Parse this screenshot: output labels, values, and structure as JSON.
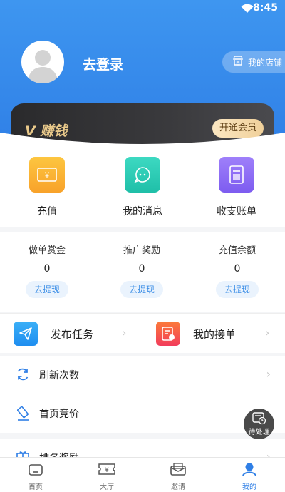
{
  "status": {
    "time": "8:45"
  },
  "profile": {
    "login_label": "去登录",
    "shop_label": "我的店铺"
  },
  "vip": {
    "title": "V 赚钱",
    "button": "开通会员"
  },
  "quick": [
    {
      "label": "充值",
      "icon": "recharge-icon",
      "color": "#fbb32c"
    },
    {
      "label": "我的消息",
      "icon": "message-icon",
      "color": "#24c9b3"
    },
    {
      "label": "收支账单",
      "icon": "bill-icon",
      "color": "#8f6df5"
    }
  ],
  "money": [
    {
      "title": "做单赏金",
      "value": "0",
      "button": "去提现"
    },
    {
      "title": "推广奖励",
      "value": "0",
      "button": "去提现"
    },
    {
      "title": "充值余额",
      "value": "0",
      "button": "去提现"
    }
  ],
  "tasks": [
    {
      "label": "发布任务",
      "icon": "send-icon",
      "color": "#2d9ef3"
    },
    {
      "label": "我的接单",
      "icon": "order-icon",
      "color": "#f4434a"
    }
  ],
  "list": [
    {
      "label": "刷新次数",
      "icon": "refresh-icon"
    },
    {
      "label": "首页竞价",
      "icon": "bid-icon"
    },
    {
      "label": "排名奖励",
      "icon": "ranking-icon"
    }
  ],
  "float": {
    "label": "待处理"
  },
  "tabs": [
    {
      "label": "首页",
      "icon": "home-icon"
    },
    {
      "label": "大厅",
      "icon": "hall-icon"
    },
    {
      "label": "邀请",
      "icon": "invite-icon"
    },
    {
      "label": "我的",
      "icon": "profile-icon"
    }
  ],
  "colors": {
    "primary": "#2f7fe6",
    "vip_gold": "#e9c98a"
  }
}
